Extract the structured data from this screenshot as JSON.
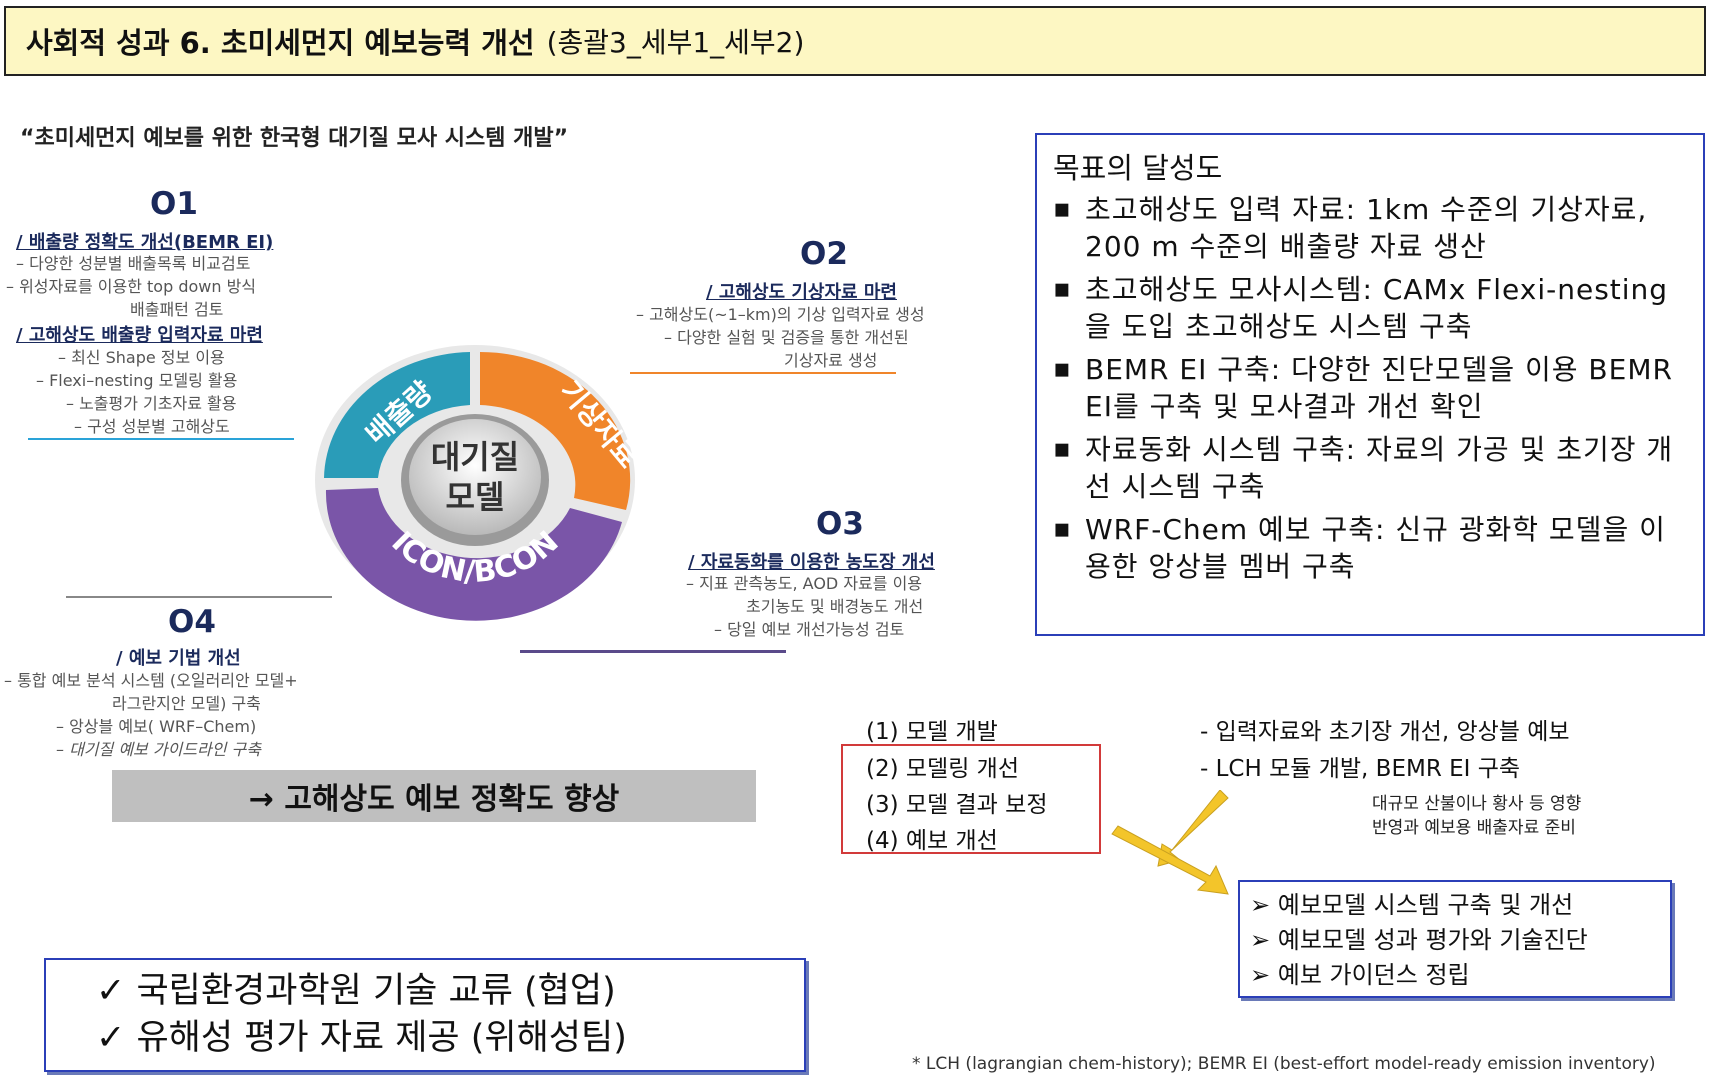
{
  "title": {
    "main": "사회적 성과 6. 초미세먼지 예보능력 개선",
    "sub": "(총괄3_세부1_세부2)"
  },
  "quote": "“초미세먼지 예보를 위한 한국형 대기질 모사 시스템 개발”",
  "o1": {
    "head": "O1",
    "title1": "/ 배출량 정확도 개선(BEMR EI)",
    "items1": [
      "– 다양한 성분별 배출목록 비교검토",
      "– 위성자료를 이용한 top down 방식",
      "배출패턴 검토"
    ],
    "title2": "/ 고해상도 배출량 입력자료 마련",
    "items2": [
      "– 최신 Shape 정보 이용",
      "– Flexi–nesting 모델링 활용",
      "– 노출평가 기초자료 활용",
      "– 구성 성분별 고해상도"
    ]
  },
  "o2": {
    "head": "O2",
    "title": "/ 고해상도 기상자료 마련",
    "items": [
      "– 고해상도(~1–km)의 기상 입력자료 생성",
      "– 다양한 실험 및 검증을 통한 개선된",
      "기상자료 생성"
    ]
  },
  "o3": {
    "head": "O3",
    "title": "/ 자료동화를 이용한 농도장 개선",
    "items": [
      "– 지표 관측농도, AOD 자료를 이용",
      "초기농도 및 배경농도 개선",
      "– 당일 예보 개선가능성 검토"
    ]
  },
  "o4": {
    "head": "O4",
    "title": "/ 예보 기법 개선",
    "items": [
      "– 통합 예보 분석 시스템 (오일러리안 모델+",
      "라그란지안 모델) 구축",
      "– 앙상블 예보( WRF–Chem)",
      "– 대기질 예보 가이드라인 구축"
    ]
  },
  "wheel": {
    "seg1": "배출량",
    "seg2": "기상자료",
    "seg3": "ICON/BCON",
    "center1": "대기질",
    "center2": "모델",
    "colors": {
      "teal": "#2a9cb8",
      "orange": "#f0852a",
      "purple": "#7a55a8"
    }
  },
  "result": "→ 고해상도 예보 정확도 향상",
  "goals": {
    "title": "목표의 달성도",
    "items": [
      "초고해상도 입력 자료: 1km 수준의 기상자료, 200 m 수준의 배출량 자료 생산",
      "초고해상도 모사시스템: CAMx Flexi-nesting 을 도입 초고해상도 시스템 구축",
      "BEMR EI 구축: 다양한 진단모델을 이용 BEMR EI를 구축 및 모사결과 개선 확인",
      "자료동화 시스템 구축: 자료의 가공 및 초기장 개선 시스템 구축",
      "WRF-Chem 예보 구축: 신규 광화학 모델을 이용한 앙상블 멤버 구축"
    ]
  },
  "steps": [
    "(1) 모델 개발",
    "(2) 모델링 개선",
    "(3) 모델 결과 보정",
    "(4) 예보 개선"
  ],
  "dash_items": [
    "- 입력자료와 초기장 개선, 앙상블 예보",
    "- LCH 모듈 개발, BEMR EI 구축"
  ],
  "note": [
    "대규모 산불이나 황사 등 영향",
    "반영과 예보용 배출자료 준비"
  ],
  "outputs": [
    "➢ 예보모델 시스템 구축 및 개선",
    "➢ 예보모델 성과 평가와 기술진단",
    "➢ 예보 가이던스 정립"
  ],
  "collab": [
    "✓  국립환경과학원 기술 교류 (협업)",
    "✓  유해성 평가 자료 제공 (위해성팀)"
  ],
  "footnote": "* LCH (lagrangian chem-history); BEMR EI (best-effort model-ready emission inventory)"
}
